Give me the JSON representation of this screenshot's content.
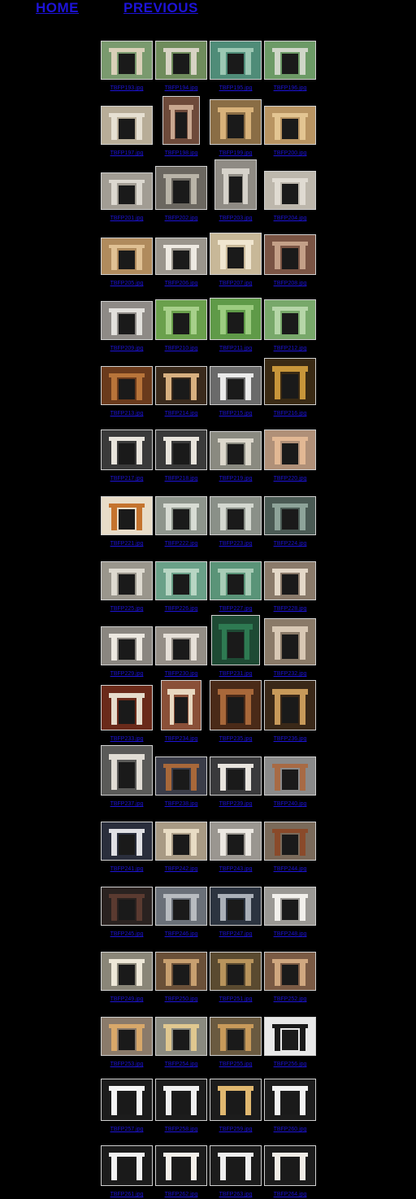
{
  "nav": {
    "home": "HOME",
    "previous": "PREVIOUS"
  },
  "gallery": [
    [
      {
        "file": "TBFP193.jpg",
        "bg": "#7a9a6e",
        "stone": "#d9d0b8"
      },
      {
        "file": "TBFP194.jpg",
        "bg": "#6f8c5c",
        "stone": "#d7d3c4"
      },
      {
        "file": "TBFP195.jpg",
        "bg": "#4f8c78",
        "stone": "#9cc7b3"
      },
      {
        "file": "TBFP196.jpg",
        "bg": "#6c9a66",
        "stone": "#cfd6c8"
      }
    ],
    [
      {
        "file": "TBFP197.jpg",
        "bg": "#b8ad98",
        "stone": "#e6e0d2"
      },
      {
        "file": "TBFP198.jpg",
        "bg": "#6e4a3a",
        "stone": "#c9a890"
      },
      {
        "file": "TBFP199.jpg",
        "bg": "#8a6d45",
        "stone": "#d8b27a"
      },
      {
        "file": "TBFP200.jpg",
        "bg": "#b89462",
        "stone": "#e3c592"
      }
    ],
    [
      {
        "file": "TBFP201.jpg",
        "bg": "#a29d94",
        "stone": "#dcd8d0"
      },
      {
        "file": "TBFP202.jpg",
        "bg": "#6b6760",
        "stone": "#b9b4a8"
      },
      {
        "file": "TBFP203.jpg",
        "bg": "#8f8b84",
        "stone": "#d6d2ca"
      },
      {
        "file": "TBFP204.jpg",
        "bg": "#bdb7ac",
        "stone": "#e0dbd2"
      }
    ],
    [
      {
        "file": "TBFP205.jpg",
        "bg": "#b08b5d",
        "stone": "#e0c194"
      },
      {
        "file": "TBFP206.jpg",
        "bg": "#9a958c",
        "stone": "#eeeae2"
      },
      {
        "file": "TBFP207.jpg",
        "bg": "#c8b898",
        "stone": "#f0e6d0"
      },
      {
        "file": "TBFP208.jpg",
        "bg": "#7a5444",
        "stone": "#c4a088"
      }
    ],
    [
      {
        "file": "TBFP209.jpg",
        "bg": "#8e8a86",
        "stone": "#e2e0dc"
      },
      {
        "file": "TBFP210.jpg",
        "bg": "#6aa04c",
        "stone": "#a7d08a"
      },
      {
        "file": "TBFP211.jpg",
        "bg": "#5f9a48",
        "stone": "#9ccc80"
      },
      {
        "file": "TBFP212.jpg",
        "bg": "#78a86a",
        "stone": "#b6d6a8"
      }
    ],
    [
      {
        "file": "TBFP213.jpg",
        "bg": "#6a3a1c",
        "stone": "#b8743a"
      },
      {
        "file": "TBFP214.jpg",
        "bg": "#3a2a1c",
        "stone": "#d8b080"
      },
      {
        "file": "TBFP215.jpg",
        "bg": "#6a6a6a",
        "stone": "#eaeaea"
      },
      {
        "file": "TBFP216.jpg",
        "bg": "#3a2a14",
        "stone": "#c8963a"
      }
    ],
    [
      {
        "file": "TBFP217.jpg",
        "bg": "#3a3a3a",
        "stone": "#e8e4dc"
      },
      {
        "file": "TBFP218.jpg",
        "bg": "#3a3a3a",
        "stone": "#e8e4dc"
      },
      {
        "file": "TBFP219.jpg",
        "bg": "#8a8a80",
        "stone": "#dcd8cc"
      },
      {
        "file": "TBFP220.jpg",
        "bg": "#b09078",
        "stone": "#e2b894"
      }
    ],
    [
      {
        "file": "TBFP221.jpg",
        "bg": "#e8dcc8",
        "stone": "#c4732e"
      },
      {
        "file": "TBFP222.jpg",
        "bg": "#8e958c",
        "stone": "#d8dcd4"
      },
      {
        "file": "TBFP223.jpg",
        "bg": "#8a9088",
        "stone": "#d4d8d0"
      },
      {
        "file": "TBFP224.jpg",
        "bg": "#4a5a54",
        "stone": "#8ea49a"
      }
    ],
    [
      {
        "file": "TBFP225.jpg",
        "bg": "#9a968c",
        "stone": "#dedad0"
      },
      {
        "file": "TBFP226.jpg",
        "bg": "#6aa088",
        "stone": "#b8d6c4"
      },
      {
        "file": "TBFP227.jpg",
        "bg": "#5a9478",
        "stone": "#a8ccb6"
      },
      {
        "file": "TBFP228.jpg",
        "bg": "#8a7a6a",
        "stone": "#e4d8c8"
      }
    ],
    [
      {
        "file": "TBFP229.jpg",
        "bg": "#8a8680",
        "stone": "#ece8e0"
      },
      {
        "file": "TBFP230.jpg",
        "bg": "#948e86",
        "stone": "#e6e0d8"
      },
      {
        "file": "TBFP231.jpg",
        "bg": "#1e4a34",
        "stone": "#2e7a52"
      },
      {
        "file": "TBFP232.jpg",
        "bg": "#8a7a68",
        "stone": "#d8c8b4"
      }
    ],
    [
      {
        "file": "TBFP233.jpg",
        "bg": "#6a2a1a",
        "stone": "#e6dccc"
      },
      {
        "file": "TBFP234.jpg",
        "bg": "#8a5038",
        "stone": "#e8d8c0"
      },
      {
        "file": "TBFP235.jpg",
        "bg": "#4a2a18",
        "stone": "#a8683a"
      },
      {
        "file": "TBFP236.jpg",
        "bg": "#3a2818",
        "stone": "#c89a5a"
      }
    ],
    [
      {
        "file": "TBFP237.jpg",
        "bg": "#5a5a58",
        "stone": "#e0dcd4"
      },
      {
        "file": "TBFP238.jpg",
        "bg": "#3a3c48",
        "stone": "#a8683a"
      },
      {
        "file": "TBFP239.jpg",
        "bg": "#3a3a3c",
        "stone": "#e8e4de"
      },
      {
        "file": "TBFP240.jpg",
        "bg": "#8a8a8a",
        "stone": "#a86a44"
      }
    ],
    [
      {
        "file": "TBFP241.jpg",
        "bg": "#2a2e3c",
        "stone": "#e0e0e4"
      },
      {
        "file": "TBFP242.jpg",
        "bg": "#a89a84",
        "stone": "#e8dcc4"
      },
      {
        "file": "TBFP243.jpg",
        "bg": "#9a9690",
        "stone": "#ece8e2"
      },
      {
        "file": "TBFP244.jpg",
        "bg": "#7a6a5a",
        "stone": "#8a4a2a"
      }
    ],
    [
      {
        "file": "TBFP245.jpg",
        "bg": "#2a2220",
        "stone": "#5a3a30"
      },
      {
        "file": "TBFP246.jpg",
        "bg": "#6a7078",
        "stone": "#b8bcc0"
      },
      {
        "file": "TBFP247.jpg",
        "bg": "#2c3440",
        "stone": "#aab0b8"
      },
      {
        "file": "TBFP248.jpg",
        "bg": "#9a9894",
        "stone": "#f2f0ec"
      }
    ],
    [
      {
        "file": "TBFP249.jpg",
        "bg": "#8a8678",
        "stone": "#eee8d8"
      },
      {
        "file": "TBFP250.jpg",
        "bg": "#6a5038",
        "stone": "#c8a070"
      },
      {
        "file": "TBFP251.jpg",
        "bg": "#5a4a30",
        "stone": "#b8945c"
      },
      {
        "file": "TBFP252.jpg",
        "bg": "#7a5a44",
        "stone": "#d0a880"
      }
    ],
    [
      {
        "file": "TBFP253.jpg",
        "bg": "#8a7a6a",
        "stone": "#d8a86a"
      },
      {
        "file": "TBFP254.jpg",
        "bg": "#8a8a80",
        "stone": "#e0c890"
      },
      {
        "file": "TBFP255.jpg",
        "bg": "#6a5a40",
        "stone": "#c89a5a"
      },
      {
        "file": "TBFP256.jpg",
        "bg": "#e8e8e8",
        "stone": "#1a1a1a"
      }
    ],
    [
      {
        "file": "TBFP257.jpg",
        "bg": "#1c1c1c",
        "stone": "#f4f4f4"
      },
      {
        "file": "TBFP258.jpg",
        "bg": "#1c1c1c",
        "stone": "#f0f0f0"
      },
      {
        "file": "TBFP259.jpg",
        "bg": "#1c1c1c",
        "stone": "#e0b870"
      },
      {
        "file": "TBFP260.jpg",
        "bg": "#1c1c1c",
        "stone": "#f2f2f2"
      }
    ],
    [
      {
        "file": "TBFP261.jpg",
        "bg": "#1c1c1c",
        "stone": "#f2f2f2"
      },
      {
        "file": "TBFP262.jpg",
        "bg": "#1c1c1c",
        "stone": "#f4f0ea"
      },
      {
        "file": "TBFP263.jpg",
        "bg": "#1c1c1c",
        "stone": "#eeeeee"
      },
      {
        "file": "TBFP264.jpg",
        "bg": "#1c1c1c",
        "stone": "#f0ece6"
      }
    ]
  ]
}
